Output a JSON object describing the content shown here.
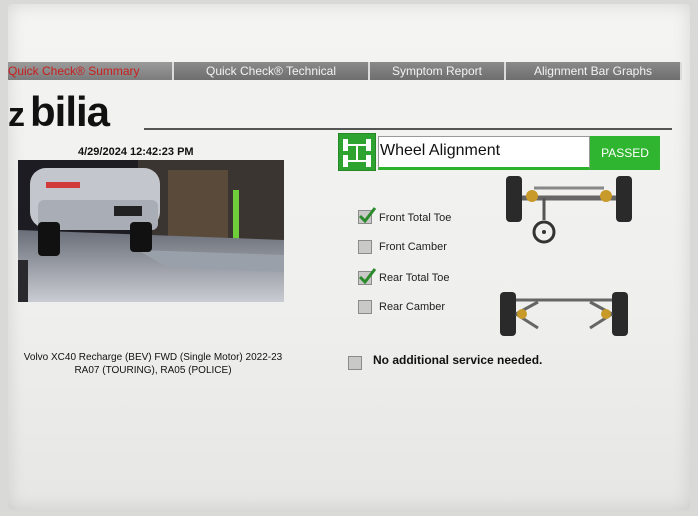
{
  "tabs": [
    {
      "label": "Quick Check® Summary",
      "active": true
    },
    {
      "label": "Quick Check® Technical",
      "active": false
    },
    {
      "label": "Symptom Report",
      "active": false
    },
    {
      "label": "Alignment Bar Graphs",
      "active": false
    }
  ],
  "brand": {
    "logo_text": "bilia"
  },
  "header": {
    "datetime": "4/29/2024 12:42:23 PM"
  },
  "alignment": {
    "title": "Wheel Alignment",
    "status": "PASSED",
    "status_color": "#2fb52f"
  },
  "checks": [
    {
      "label": "Front Total Toe",
      "checked": true
    },
    {
      "label": "Front Camber",
      "checked": false
    },
    {
      "label": "Rear Total Toe",
      "checked": true
    },
    {
      "label": "Rear Camber",
      "checked": false
    }
  ],
  "service": {
    "message": "No additional service needed.",
    "checked": false
  },
  "vehicle": {
    "line1": "Volvo XC40 Recharge (BEV) FWD (Single Motor) 2022-23",
    "line2": "RA07 (TOURING), RA05 (POLICE)"
  },
  "icons": {
    "alignment": "wheel-alignment-icon",
    "front_axle": "front-axle-icon",
    "rear_axle": "rear-axle-icon"
  }
}
